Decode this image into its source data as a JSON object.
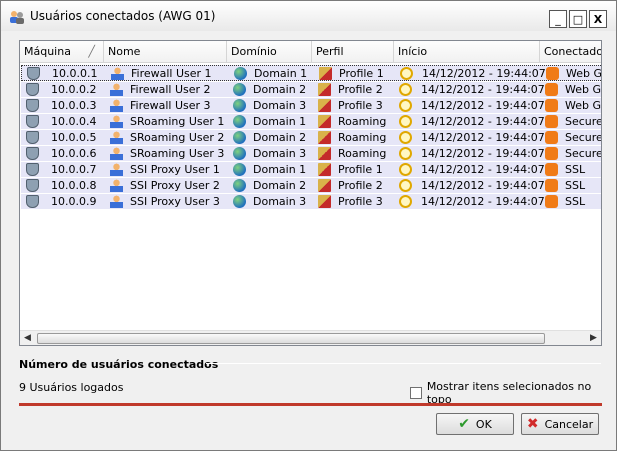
{
  "window": {
    "title": "Usuários conectados (AWG 01)"
  },
  "window_controls": {
    "minimize": "_",
    "maximize": "□",
    "close": "X"
  },
  "table": {
    "columns": [
      "Máquina",
      "Nome",
      "Domínio",
      "Perfil",
      "Início",
      "Conectado"
    ],
    "rows": [
      [
        "10.0.0.1",
        "Firewall User 1",
        "Domain 1",
        "Profile 1",
        "14/12/2012 - 19:44:07",
        "Web G"
      ],
      [
        "10.0.0.2",
        "Firewall User 2",
        "Domain 2",
        "Profile 2",
        "14/12/2012 - 19:44:07",
        "Web G"
      ],
      [
        "10.0.0.3",
        "Firewall User 3",
        "Domain 3",
        "Profile 3",
        "14/12/2012 - 19:44:07",
        "Web G"
      ],
      [
        "10.0.0.4",
        "SRoaming User 1",
        "Domain 1",
        "Roaming",
        "14/12/2012 - 19:44:07",
        "Secure"
      ],
      [
        "10.0.0.5",
        "SRoaming User 2",
        "Domain 2",
        "Roaming",
        "14/12/2012 - 19:44:07",
        "Secure"
      ],
      [
        "10.0.0.6",
        "SRoaming User 3",
        "Domain 3",
        "Roaming",
        "14/12/2012 - 19:44:07",
        "Secure"
      ],
      [
        "10.0.0.7",
        "SSI Proxy User 1",
        "Domain 1",
        "Profile 1",
        "14/12/2012 - 19:44:07",
        "SSL"
      ],
      [
        "10.0.0.8",
        "SSI Proxy User 2",
        "Domain 2",
        "Profile 2",
        "14/12/2012 - 19:44:07",
        "SSL"
      ],
      [
        "10.0.0.9",
        "SSI Proxy User 3",
        "Domain 3",
        "Profile 3",
        "14/12/2012 - 19:44:07",
        "SSL"
      ]
    ]
  },
  "summary": {
    "title": "Número de usuários conectados",
    "count_text": "9 Usuários logados",
    "show_selected_label": "Mostrar itens selecionados no topo"
  },
  "buttons": {
    "ok": "OK",
    "cancel": "Cancelar"
  },
  "icons": {
    "machine": "shield-icon",
    "user": "user-icon",
    "domain": "globe-icon",
    "profile": "profile-icon",
    "start": "clock-icon",
    "connection": "connection-icon"
  },
  "colors": {
    "row_highlight": "#e6e6f7",
    "accent_line": "#c0392b"
  }
}
